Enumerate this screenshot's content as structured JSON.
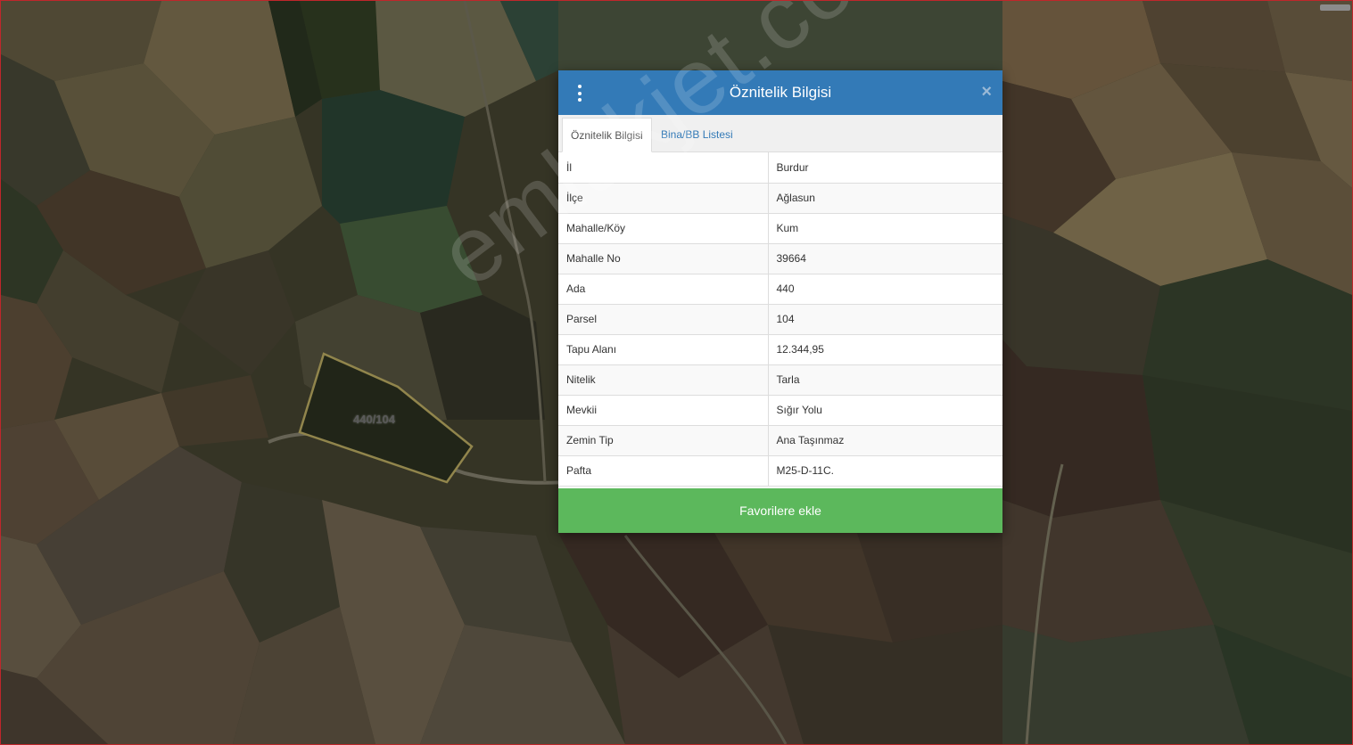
{
  "map": {
    "parcel_label": "440/104",
    "watermark": "emlakjet.com"
  },
  "dialog": {
    "title": "Öznitelik Bilgisi",
    "tabs": [
      {
        "label": "Öznitelik Bilgisi",
        "active": true
      },
      {
        "label": "Bina/BB Listesi",
        "active": false
      }
    ],
    "rows": [
      {
        "key": "İl",
        "value": "Burdur"
      },
      {
        "key": "İlçe",
        "value": "Ağlasun"
      },
      {
        "key": "Mahalle/Köy",
        "value": "Kum"
      },
      {
        "key": "Mahalle No",
        "value": "39664"
      },
      {
        "key": "Ada",
        "value": "440"
      },
      {
        "key": "Parsel",
        "value": "104"
      },
      {
        "key": "Tapu Alanı",
        "value": "12.344,95"
      },
      {
        "key": "Nitelik",
        "value": "Tarla"
      },
      {
        "key": "Mevkii",
        "value": "Sığır Yolu"
      },
      {
        "key": "Zemin Tip",
        "value": "Ana Taşınmaz"
      },
      {
        "key": "Pafta",
        "value": "M25-D-11C."
      }
    ],
    "favorite_button": "Favorilere ekle"
  },
  "colors": {
    "header": "#337ab7",
    "favorite": "#5cb85c",
    "parcel_outline": "#c9b96a",
    "viewport_border": "#c0262b"
  },
  "icons": {
    "menu": "vertical-dots-icon",
    "close": "close-icon"
  }
}
